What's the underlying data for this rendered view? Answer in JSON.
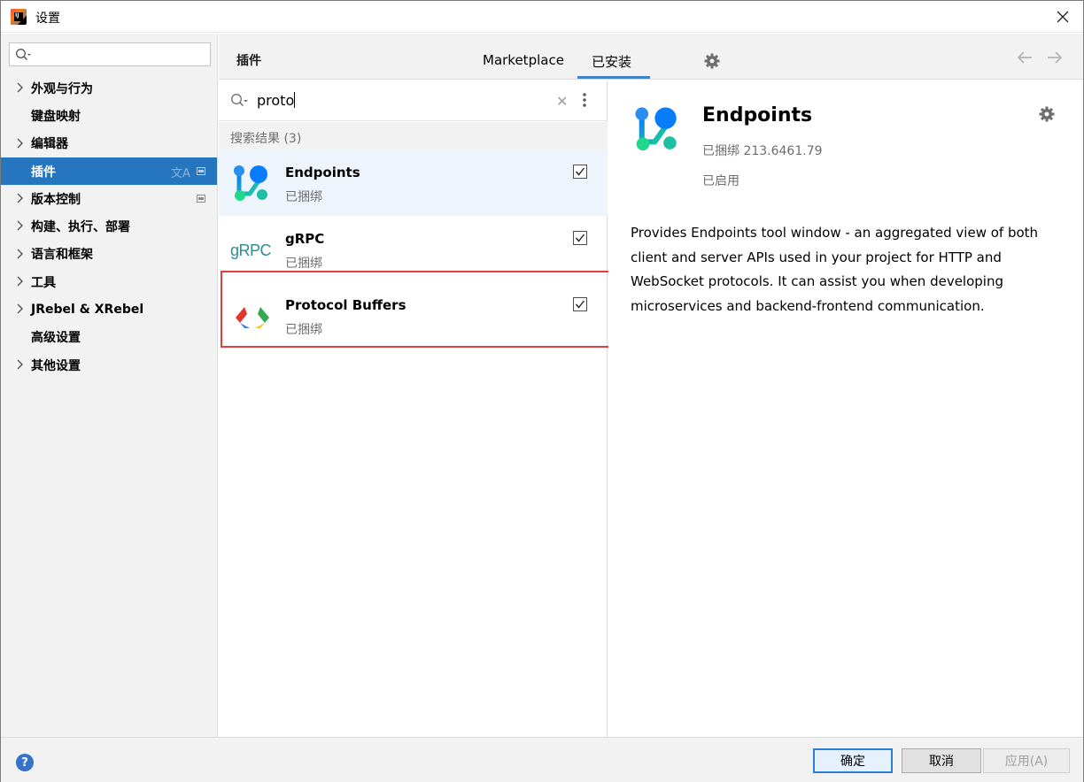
{
  "window": {
    "title": "设置"
  },
  "sidebar": {
    "search_placeholder": "",
    "items": [
      {
        "label": "外观与行为",
        "expandable": true
      },
      {
        "label": "键盘映射",
        "expandable": false
      },
      {
        "label": "编辑器",
        "expandable": true
      },
      {
        "label": "插件",
        "expandable": false,
        "active": true
      },
      {
        "label": "版本控制",
        "expandable": true
      },
      {
        "label": "构建、执行、部署",
        "expandable": true
      },
      {
        "label": "语言和框架",
        "expandable": true
      },
      {
        "label": "工具",
        "expandable": true
      },
      {
        "label": "JRebel & XRebel",
        "expandable": true
      },
      {
        "label": "高级设置",
        "expandable": false
      },
      {
        "label": "其他设置",
        "expandable": true
      }
    ]
  },
  "header": {
    "title": "插件",
    "tabs": [
      {
        "label": "Marketplace",
        "active": false
      },
      {
        "label": "已安装",
        "active": true
      }
    ]
  },
  "plugin_list": {
    "search_query": "proto",
    "results_label": "搜索结果 (3)",
    "plugins": [
      {
        "name": "Endpoints",
        "status": "已捆绑",
        "checked": true,
        "selected": true,
        "icon": "endpoints-icon"
      },
      {
        "name": "gRPC",
        "status": "已捆绑",
        "checked": true,
        "selected": false,
        "icon": "grpc-icon",
        "logo_text": "gRPC"
      },
      {
        "name": "Protocol Buffers",
        "status": "已捆绑",
        "checked": true,
        "selected": false,
        "icon": "protocol-buffers-icon"
      }
    ]
  },
  "detail": {
    "name": "Endpoints",
    "version": "已捆绑 213.6461.79",
    "state": "已启用",
    "description": "Provides Endpoints tool window - an aggregated view of both client and server APIs used in your project for HTTP and WebSocket protocols. It can assist you when developing microservices and backend-frontend communication."
  },
  "footer": {
    "help": "?",
    "ok_label": "确定",
    "cancel_label": "取消",
    "apply_label": "应用(A)"
  },
  "colors": {
    "accent": "#2675bf",
    "highlight_box": "#e53e3e",
    "selected_row": "#edf4fc"
  }
}
